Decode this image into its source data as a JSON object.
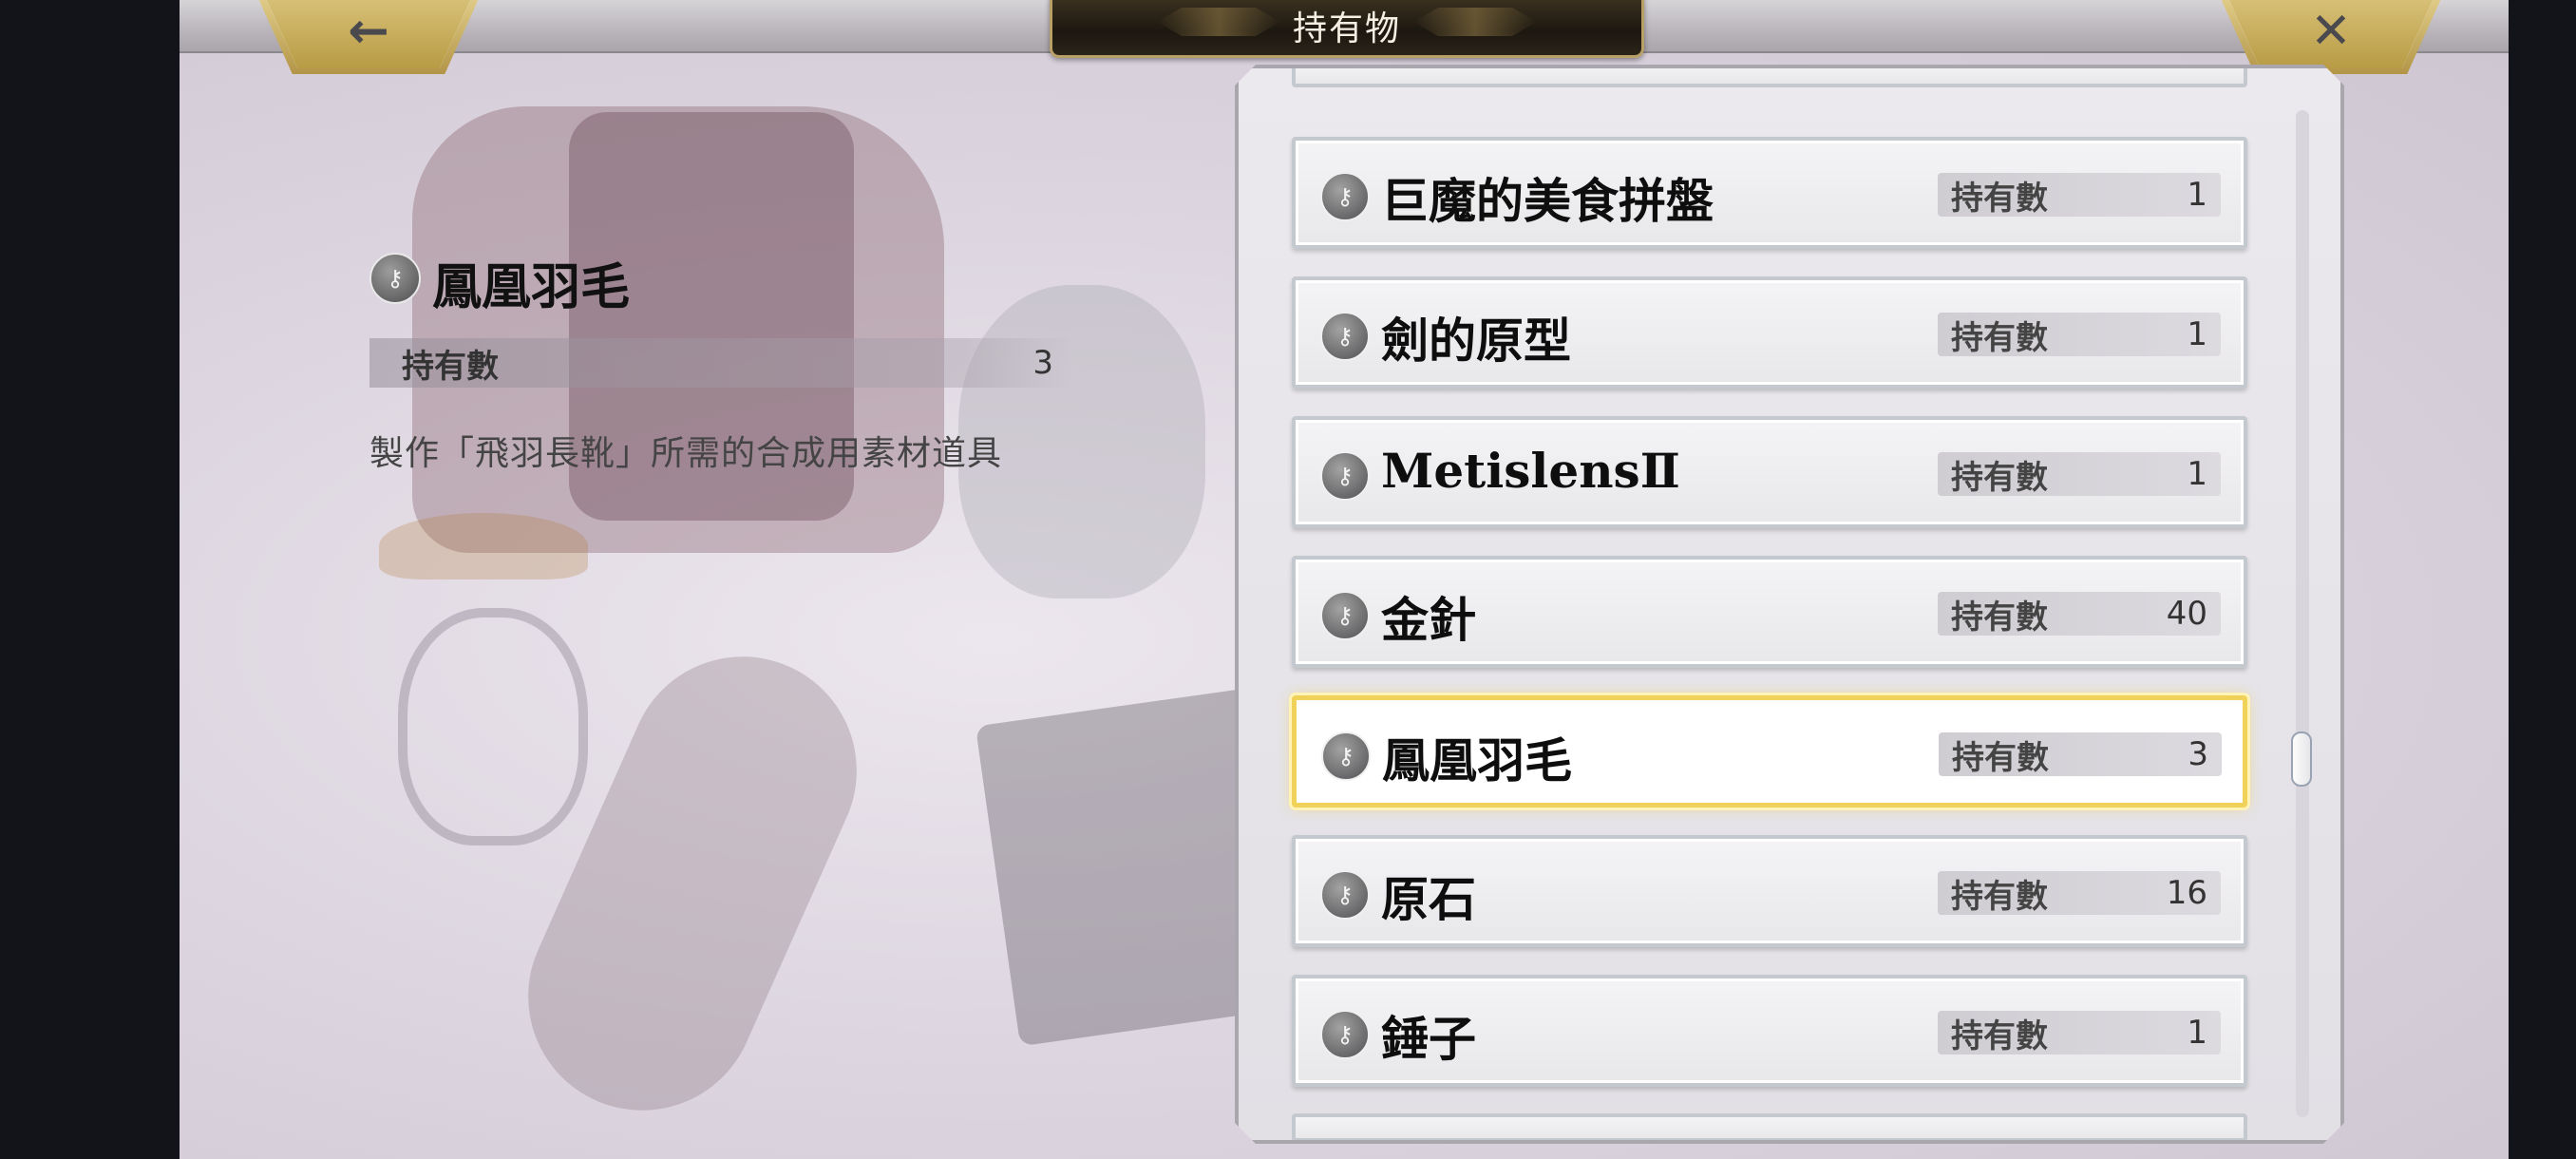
{
  "header": {
    "title": "持有物",
    "back_icon": "←",
    "close_icon": "✕"
  },
  "detail": {
    "icon": "⚷",
    "name": "鳳凰羽毛",
    "count_label": "持有數",
    "count_value": "3",
    "description": "製作「飛羽長靴」所需的合成用素材道具"
  },
  "list": {
    "count_label": "持有數",
    "icon": "⚷",
    "items": [
      {
        "name": "巨魔的美食拼盤",
        "count": "1"
      },
      {
        "name": "劍的原型",
        "count": "1"
      },
      {
        "name": "MetislensⅡ",
        "count": "1"
      },
      {
        "name": "金針",
        "count": "40"
      },
      {
        "name": "鳳凰羽毛",
        "count": "3"
      },
      {
        "name": "原石",
        "count": "16"
      },
      {
        "name": "錘子",
        "count": "1"
      }
    ],
    "selected_index": 4,
    "scroll_position": 0.58
  },
  "colors": {
    "selected_border": "#f0d25a",
    "title_plate": "#1c1710"
  }
}
